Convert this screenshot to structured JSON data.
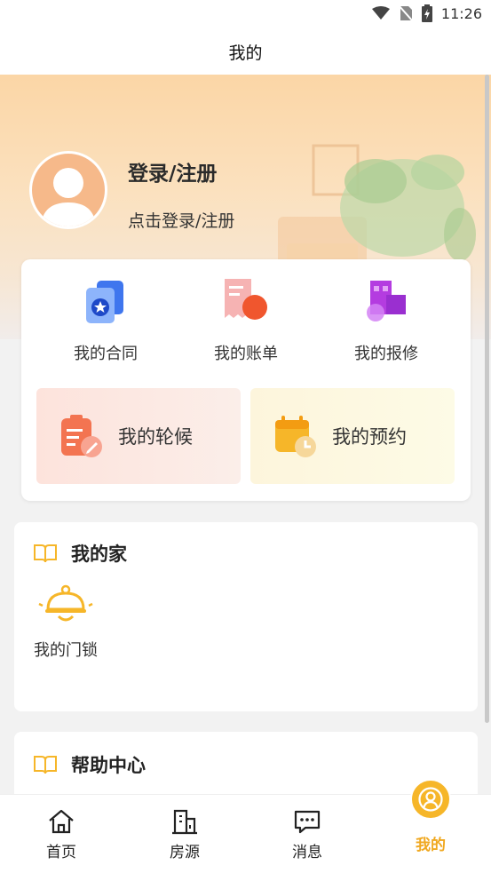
{
  "status": {
    "time": "11:26"
  },
  "page": {
    "title": "我的"
  },
  "profile": {
    "title": "登录/注册",
    "subtitle": "点击登录/注册"
  },
  "quick": [
    {
      "label": "我的合同",
      "icon": "contract-icon"
    },
    {
      "label": "我的账单",
      "icon": "bill-icon"
    },
    {
      "label": "我的报修",
      "icon": "repair-icon"
    }
  ],
  "tiles": {
    "queue": {
      "label": "我的轮候",
      "icon": "queue-icon"
    },
    "booking": {
      "label": "我的预约",
      "icon": "calendar-icon"
    }
  },
  "home": {
    "title": "我的家",
    "items": [
      {
        "label": "我的门锁",
        "icon": "door-lock-icon"
      }
    ]
  },
  "help": {
    "title": "帮助中心"
  },
  "tabs": [
    {
      "label": "首页",
      "icon": "home-icon"
    },
    {
      "label": "房源",
      "icon": "building-icon"
    },
    {
      "label": "消息",
      "icon": "message-icon"
    },
    {
      "label": "我的",
      "icon": "user-icon",
      "active": true
    }
  ],
  "colors": {
    "accent": "#f6b629",
    "active_tab_text": "#f0a820",
    "hero_start": "#fbd6a6"
  }
}
